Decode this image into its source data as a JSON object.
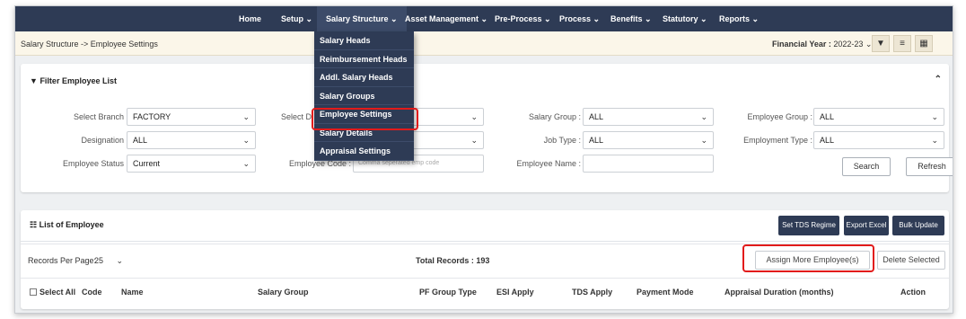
{
  "nav": {
    "items": [
      {
        "label": "Home"
      },
      {
        "label": "Setup ⌄"
      },
      {
        "label": "Salary Structure ⌄"
      },
      {
        "label": "Asset Management ⌄"
      },
      {
        "label": "Pre-Process ⌄"
      },
      {
        "label": "Process ⌄"
      },
      {
        "label": "Benefits ⌄"
      },
      {
        "label": "Statutory ⌄"
      },
      {
        "label": "Reports ⌄"
      }
    ]
  },
  "dropdown": {
    "items": [
      {
        "label": "Salary Heads"
      },
      {
        "label": "Reimbursement Heads"
      },
      {
        "label": "Addl. Salary Heads"
      },
      {
        "label": "Salary Groups"
      },
      {
        "label": "Employee Settings"
      },
      {
        "label": "Salary Details"
      },
      {
        "label": "Appraisal Settings"
      }
    ]
  },
  "breadcrumb": "Salary Structure -> Employee Settings",
  "financial_year": {
    "label": "Financial Year :",
    "value": "2022-23 ⌄"
  },
  "tools": {
    "filter": "▼",
    "menu": "≡",
    "calc": "▦"
  },
  "filter": {
    "title": "Filter Employee List",
    "title_icon": "▼",
    "collapse_icon": "⌃",
    "select_branch_label": "Select Branch :",
    "select_branch_value": "FACTORY",
    "select_dept_label": "Select D",
    "salary_group_label": "Salary Group :",
    "salary_group_value": "ALL",
    "employee_group_label": "Employee Group :",
    "employee_group_value": "ALL",
    "designation_label": "Designation :",
    "designation_value": "ALL",
    "job_type_label": "Job Type :",
    "job_type_value": "ALL",
    "employment_type_label": "Employment Type :",
    "employment_type_value": "ALL",
    "employee_status_label": "Employee Status :",
    "employee_status_value": "Current",
    "employee_code_label": "Employee Code :",
    "employee_code_placeholder": "Comma seperated emp code",
    "employee_name_label": "Employee Name :",
    "search_label": "Search",
    "refresh_label": "Refresh",
    "chevron": "⌄"
  },
  "list": {
    "title": "List of Employee",
    "title_icon": "☷",
    "set_tds_label": "Set TDS Regime",
    "export_excel_label": "Export Excel",
    "bulk_update_label": "Bulk Update",
    "records_per_page_label": "Records Per Page:",
    "records_per_page_value": "25",
    "total_records": "Total Records : 193",
    "assign_more_label": "Assign More Employee(s)",
    "delete_selected_label": "Delete Selected",
    "columns": {
      "select_all": "Select All",
      "code": "Code",
      "name": "Name",
      "salary_group": "Salary Group",
      "pf_group_type": "PF Group Type",
      "esi_apply": "ESI Apply",
      "tds_apply": "TDS Apply",
      "payment_mode": "Payment Mode",
      "appraisal_duration": "Appraisal Duration (months)",
      "action": "Action"
    }
  },
  "colors": {
    "nav_bg": "#2e3b55",
    "highlight": "#e21b1b",
    "breadcrumb_bg": "#fbf6e9"
  }
}
